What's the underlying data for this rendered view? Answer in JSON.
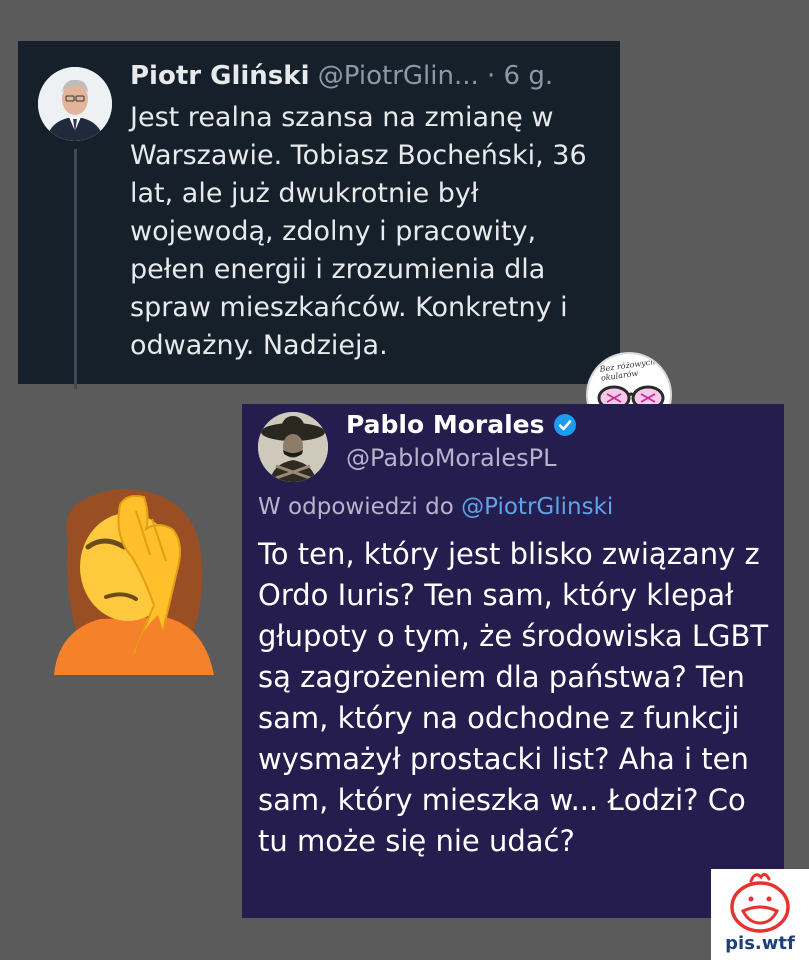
{
  "tweet1": {
    "author_name": "Piotr Gliński",
    "author_handle": "@PiotrGlin...",
    "time": "· 6 g.",
    "text": "Jest realna szansa na zmianę w Warszawie. Tobiasz Bocheński, 36 lat, ale już dwukrotnie był wojewodą, zdolny i pracowity, pełen energii i zrozumienia dla spraw mieszkańców. Konkretny i odważny. Nadzieja."
  },
  "tweet2": {
    "author_name": "Pablo Morales",
    "author_handle": "@PabloMoralesPL",
    "reply_prefix": "W odpowiedzi do",
    "reply_mention": "@PiotrGlinski",
    "text": "To ten, który jest blisko związany z Ordo Iuris? Ten sam, który klepał głupoty o tym, że środowiska LGBT są zagrożeniem dla państwa? Ten sam, który na odchodne z funkcji wysmażył prostacki list? Aha i ten sam, który mieszka w... Łodzi? Co tu może się nie udać?"
  },
  "sticker": {
    "text": "Bez różowych okularów"
  },
  "logo": {
    "text": "pis.wtf"
  },
  "colors": {
    "background": "#5b5b5b",
    "tweet1_bg": "#15202b",
    "tweet2_bg": "#251d4d",
    "mention": "#5ca5e8",
    "verified": "#1d9bf0",
    "logo_red": "#e8322f",
    "logo_blue": "#1f3f78"
  },
  "icons": [
    "avatar-glinski",
    "avatar-morales",
    "verified-badge-icon",
    "facepalm-emoji",
    "sticker-glasses-icon",
    "pis-wtf-logo-icon"
  ]
}
